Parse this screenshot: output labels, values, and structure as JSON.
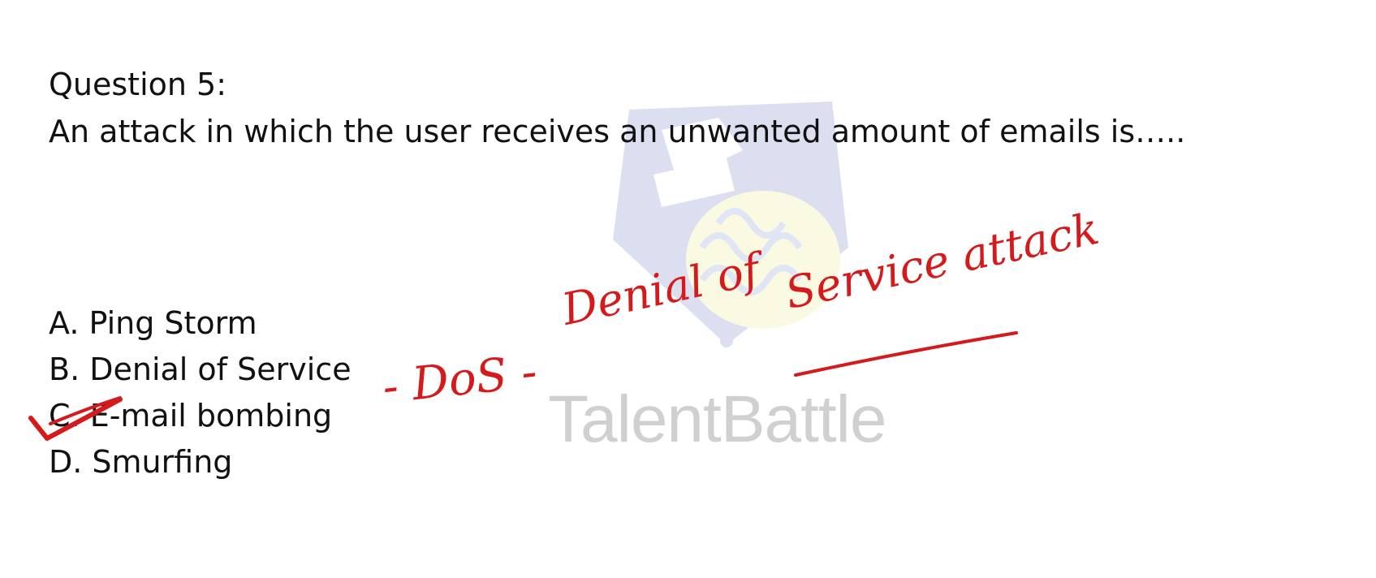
{
  "question": {
    "title": "Question 5:",
    "text": "An attack in which the user receives an unwanted amount of emails is….."
  },
  "options": [
    {
      "label": "A. Ping Storm"
    },
    {
      "label": "B. Denial of Service"
    },
    {
      "label": "C. E-mail bombing"
    },
    {
      "label": "D. Smurfing"
    }
  ],
  "annotation": {
    "dos": "- DoS -",
    "denial": "Denial of",
    "service": "Service attack",
    "color": "#d6191b"
  },
  "watermark": {
    "text": "TalentBattle"
  }
}
